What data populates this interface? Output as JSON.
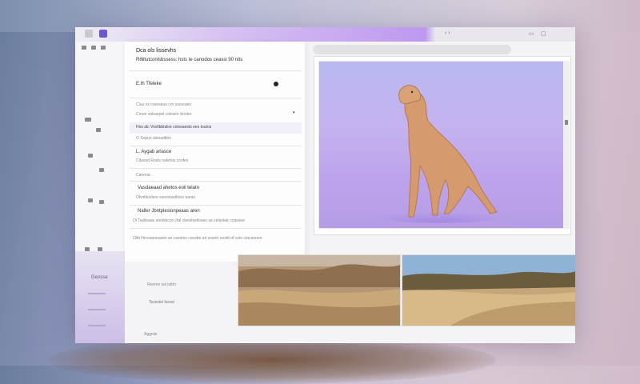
{
  "titlebar": {
    "app_title": ""
  },
  "sidebar": {
    "lower_label_1": "Geosse",
    "lower_label_2": "",
    "lower_label_3": ""
  },
  "panel": {
    "heading": "Dca ols lissevhs",
    "subheading": "Rðiitutconlsbssess: hsts te canodos ceassi 90 ntts",
    "item1_title": "E.th Tfeleke",
    "item1_sub": "Cluu os creeseuu crn cocoraeo",
    "item1_sub2": "Cmon oobaepel cotraoir clrcitor",
    "strip_text": "Hos alc Vovlibbtsloe cnlosaests ees toutos",
    "item2_sub": "O Sopus aleoadtitrs",
    "section2_title": "L. Aygab arlasce",
    "section2_sub": "Cltaosd Rosls naletsis coofes",
    "section2_sub2": "Canona",
    "section3_title": "Vasdaeaad ahetos eoil telatn",
    "section3_sub": "Olvnlttoelsre ssovotsetlisss aarao",
    "section4_title": "Naller Jbntplesionpeaas aren",
    "section4_sub": "Oi Taslleaas anolsbcce cfal cleeslsetloseo sa celastatr cnassee",
    "footer_text": "Oltit Hrcoasrsoasto an cseelos coostte ed sosetr oosttt of cole ctaceooen",
    "lower_text_1": "Reomo sal isttm",
    "lower_text_2": "Tessstel lsssst",
    "lower_text_3": "Aggeiie"
  },
  "colors": {
    "accent": "#bd98f0",
    "preview_bg": "#c2b0ee"
  }
}
